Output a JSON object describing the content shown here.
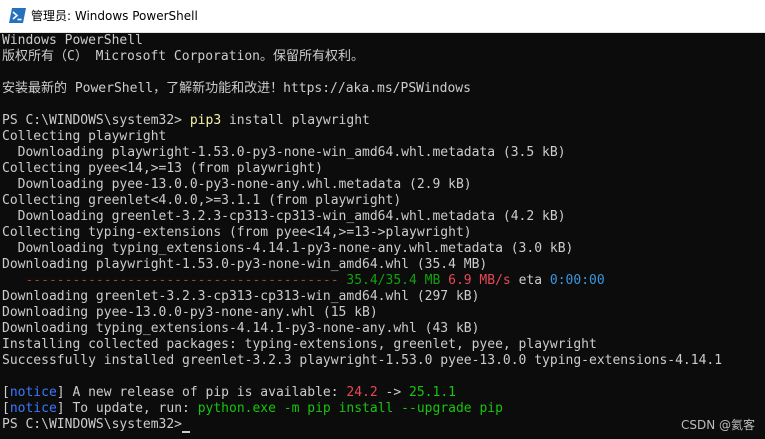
{
  "window": {
    "title": "管理员: Windows PowerShell"
  },
  "colors": {
    "background": "#0c0c0c",
    "text": "#cccccc",
    "command": "#f9f1a5",
    "progress": "#13a10e",
    "speed": "#e74856",
    "eta": "#3a96dd",
    "notice": "#3b78ff"
  },
  "terminal": {
    "banner1": "Windows PowerShell",
    "banner2": "版权所有（C） Microsoft Corporation。保留所有权利。",
    "banner3": "安装最新的 PowerShell，了解新功能和改进！https://aka.ms/PSWindows",
    "prompt": "PS C:\\WINDOWS\\system32>",
    "cmd_name": "pip3",
    "cmd_args": "install playwright",
    "l1": "Collecting playwright",
    "l2": "  Downloading playwright-1.53.0-py3-none-win_amd64.whl.metadata (3.5 kB)",
    "l3": "Collecting pyee<14,>=13 (from playwright)",
    "l4": "  Downloading pyee-13.0.0-py3-none-any.whl.metadata (2.9 kB)",
    "l5": "Collecting greenlet<4.0.0,>=3.1.1 (from playwright)",
    "l6": "  Downloading greenlet-3.2.3-cp313-cp313-win_amd64.whl.metadata (4.2 kB)",
    "l7": "Collecting typing-extensions (from pyee<14,>=13->playwright)",
    "l8": "  Downloading typing_extensions-4.14.1-py3-none-any.whl.metadata (3.0 kB)",
    "l9": "Downloading playwright-1.53.0-py3-none-win_amd64.whl (35.4 MB)",
    "progress_bar": "   ----------------------------------------",
    "progress_size": "35.4/35.4 MB",
    "progress_speed": "6.9 MB/s",
    "progress_eta_label": "eta",
    "progress_eta": "0:00:00",
    "l10": "Downloading greenlet-3.2.3-cp313-cp313-win_amd64.whl (297 kB)",
    "l11": "Downloading pyee-13.0.0-py3-none-any.whl (15 kB)",
    "l12": "Downloading typing_extensions-4.14.1-py3-none-any.whl (43 kB)",
    "l13": "Installing collected packages: typing-extensions, greenlet, pyee, playwright",
    "l14": "Successfully installed greenlet-3.2.3 playwright-1.53.0 pyee-13.0.0 typing-extensions-4.14.1",
    "notice_word": "notice",
    "notice1_text": " A new release of pip is available: ",
    "notice1_old": "24.2",
    "notice1_arrow": " -> ",
    "notice1_new": "25.1.1",
    "notice2_text": " To update, run: ",
    "notice2_cmd": "python.exe -m pip install --upgrade pip"
  },
  "watermark": "CSDN @氦客"
}
